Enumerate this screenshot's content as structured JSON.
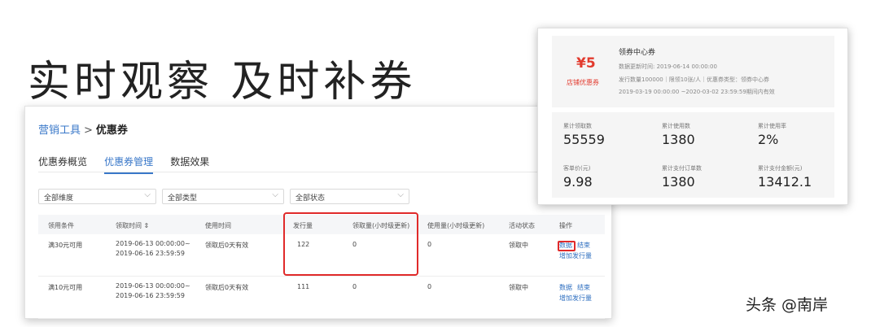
{
  "headline": "实时观察 及时补券",
  "breadcrumb": {
    "parent": "营销工具",
    "separator": ">",
    "current": "优惠券"
  },
  "tabs": [
    {
      "label": "优惠券概览"
    },
    {
      "label": "优惠券管理"
    },
    {
      "label": "数据效果"
    }
  ],
  "filters": [
    {
      "value": "全部维度"
    },
    {
      "value": "全部类型"
    },
    {
      "value": "全部状态"
    }
  ],
  "table": {
    "headers": [
      "领用条件",
      "领取时间 ⇕",
      "使用时间",
      "发行量",
      "领取量(小时级更新)",
      "使用量(小时级更新)",
      "活动状态",
      "操作"
    ],
    "rows": [
      {
        "condition": "满30元可用",
        "time_start": "2019-06-13 00:00:00~",
        "time_end": "2019-06-16 23:59:59",
        "use_time": "领取后0天有效",
        "issued": "122",
        "claimed": "0",
        "used": "0",
        "status": "领取中",
        "actions": {
          "data": "数据",
          "end": "结束",
          "add": "增加发行量"
        }
      },
      {
        "condition": "满10元可用",
        "time_start": "2019-06-13 00:00:00~",
        "time_end": "2019-06-16 23:59:59",
        "use_time": "领取后0天有效",
        "issued": "111",
        "claimed": "0",
        "used": "0",
        "status": "领取中",
        "actions": {
          "data": "数据",
          "end": "结束",
          "add": "增加发行量"
        }
      }
    ]
  },
  "coupon_card": {
    "amount": "¥5",
    "type": "店铺优惠券",
    "title": "领券中心券",
    "update_time": "数据更新时间: 2019-06-14 00:00:00",
    "details": "发行数量100000｜限领10张/人｜优惠券类型：领券中心券",
    "validity": "2019-03-19 00:00:00 ~2020-03-02 23:59:59期间内有效",
    "stats": [
      {
        "label": "累计领取数",
        "value": "55559"
      },
      {
        "label": "累计使用数",
        "value": "1380"
      },
      {
        "label": "累计使用率",
        "value": "2%"
      },
      {
        "label": "客单价(元)",
        "value": "9.98"
      },
      {
        "label": "累计支付订单数",
        "value": "1380"
      },
      {
        "label": "累计支付金额(元)",
        "value": "13412.1"
      }
    ]
  },
  "watermark": "头条 @南岸",
  "colors": {
    "link": "#3a78c9",
    "highlight": "#e02a2a",
    "coupon": "#e23b2e"
  }
}
